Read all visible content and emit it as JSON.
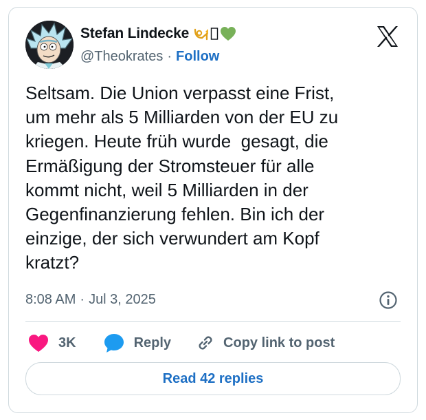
{
  "author": {
    "display_name": "Stefan Lindecke",
    "handle": "@Theokrates",
    "separator": "·",
    "follow_label": "Follow",
    "badge_emojis": [
      "trumpet",
      "unknown-glyph",
      "green-heart"
    ],
    "avatar_icon": "rick-cartoon-avatar"
  },
  "platform_icon": "x-logo-icon",
  "tweet": {
    "text": "Seltsam. Die Union verpasst eine Frist,\num mehr als 5 Milliarden von der EU zu\nkriegen. Heute früh wurde  gesagt, die\nErmäßigung der Stromsteuer für alle\nkommt nicht, weil 5 Milliarden in der\nGegenfinanzierung fehlen. Bin ich der\neinzige, der sich verwundert am Kopf\nkratzt?",
    "time": "8:08 AM",
    "date": "Jul 3, 2025",
    "separator": "·"
  },
  "actions": {
    "like_count": "3K",
    "reply_label": "Reply",
    "copy_label": "Copy link to post"
  },
  "read_replies_label": "Read 42 replies",
  "colors": {
    "link_blue": "#1d6fc4",
    "like_pink": "#f91880",
    "reply_blue": "#1d9bf0",
    "text": "#0f1419",
    "muted": "#536471",
    "border": "#cfd9de"
  }
}
